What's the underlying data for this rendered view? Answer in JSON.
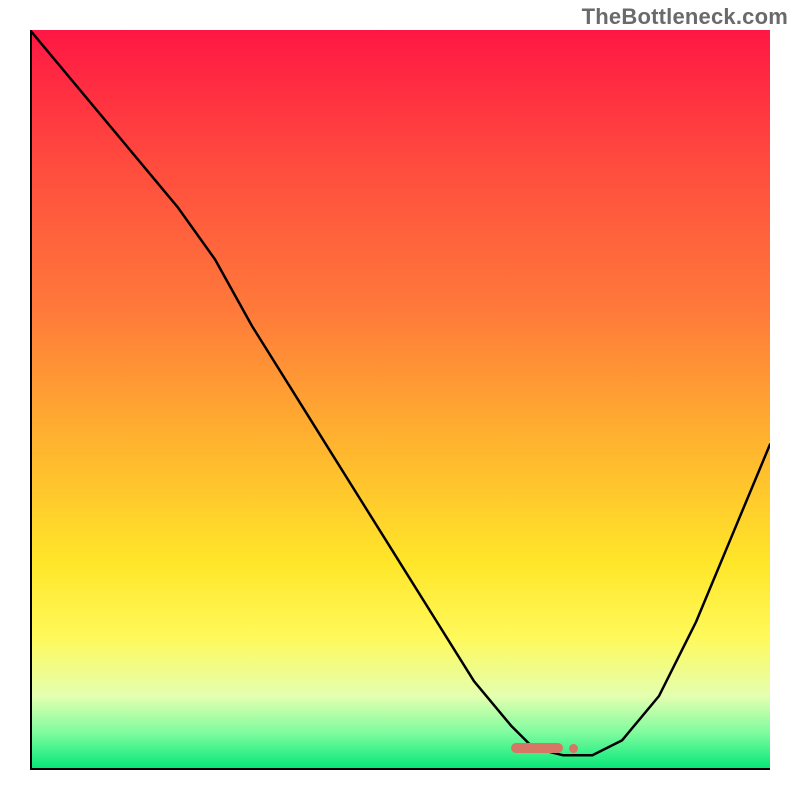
{
  "watermark": "TheBottleneck.com",
  "chart_data": {
    "type": "line",
    "title": "",
    "xlabel": "",
    "ylabel": "",
    "xlim": [
      0,
      100
    ],
    "ylim": [
      0,
      100
    ],
    "grid": false,
    "legend": false,
    "series": [
      {
        "name": "bottleneck-curve",
        "x": [
          0,
          5,
          10,
          15,
          20,
          25,
          30,
          35,
          40,
          45,
          50,
          55,
          60,
          65,
          68,
          72,
          76,
          80,
          85,
          90,
          95,
          100
        ],
        "values": [
          100,
          94,
          88,
          82,
          76,
          69,
          60,
          52,
          44,
          36,
          28,
          20,
          12,
          6,
          3,
          2,
          2,
          4,
          10,
          20,
          32,
          44
        ]
      }
    ],
    "markers": [
      {
        "name": "optimal-range",
        "x_start": 65,
        "x_end": 72,
        "y": 3
      }
    ],
    "background_gradient": {
      "stops": [
        {
          "pos": 0.0,
          "color": "#ff1744"
        },
        {
          "pos": 0.18,
          "color": "#ff4b3e"
        },
        {
          "pos": 0.38,
          "color": "#ff7a3a"
        },
        {
          "pos": 0.55,
          "color": "#ffb12f"
        },
        {
          "pos": 0.72,
          "color": "#ffe629"
        },
        {
          "pos": 0.82,
          "color": "#fff95a"
        },
        {
          "pos": 0.9,
          "color": "#e4ffb0"
        },
        {
          "pos": 0.95,
          "color": "#7efc9f"
        },
        {
          "pos": 1.0,
          "color": "#00e676"
        }
      ]
    }
  }
}
